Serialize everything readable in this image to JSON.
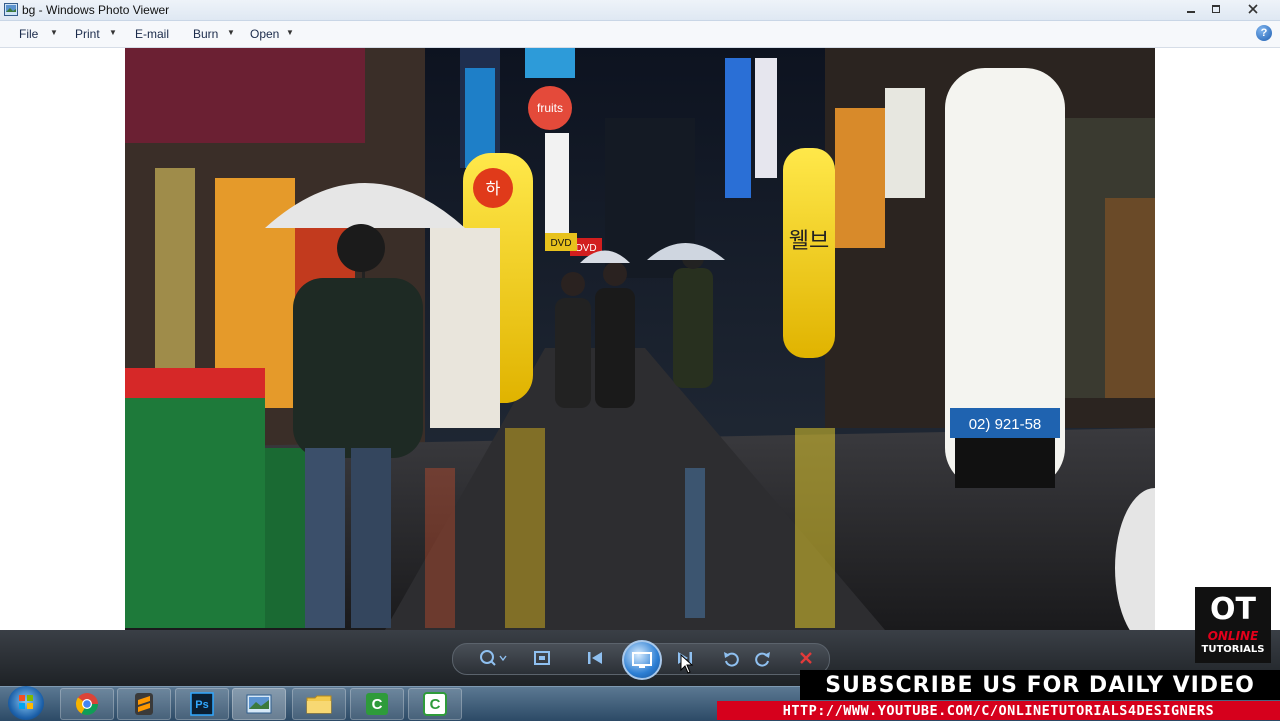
{
  "window": {
    "title": "bg - Windows Photo Viewer"
  },
  "menu": {
    "items": [
      {
        "label": "File",
        "has_dropdown": true
      },
      {
        "label": "Print",
        "has_dropdown": true
      },
      {
        "label": "E-mail",
        "has_dropdown": false
      },
      {
        "label": "Burn",
        "has_dropdown": true
      },
      {
        "label": "Open",
        "has_dropdown": true
      }
    ],
    "help_glyph": "?"
  },
  "photo": {
    "description_icon": "photo-image",
    "signs": {
      "fruits": "fruits",
      "dvd1": "DVD",
      "dvd2": "DVD",
      "shop_phone": "02) 921-58",
      "pillar_left_top": "하",
      "pillar_center": "웰브"
    }
  },
  "controls": {
    "items": [
      "zoom-icon",
      "actual-size-icon",
      "previous-icon",
      "slideshow-icon",
      "next-icon",
      "rotate-left-icon",
      "rotate-right-icon",
      "delete-icon"
    ]
  },
  "taskbar": {
    "apps": [
      "chrome-icon",
      "sublime-icon",
      "photoshop-icon",
      "photo-viewer-icon",
      "folder-icon",
      "camtasia-icon",
      "camtasia-recorder-icon"
    ]
  },
  "overlay": {
    "logo_text": "OT",
    "logo_sub1": "ONLINE",
    "logo_sub2": "TUTORIALS",
    "subscribe": "SUBSCRIBE US FOR DAILY VIDEO",
    "url": "HTTP://WWW.YOUTUBE.COM/C/ONLINETUTORIALS4DESIGNERS"
  },
  "colors": {
    "accent_red": "#d6001c",
    "title_bg": "#dfe8f3",
    "controls_bg": "#2b3036"
  }
}
